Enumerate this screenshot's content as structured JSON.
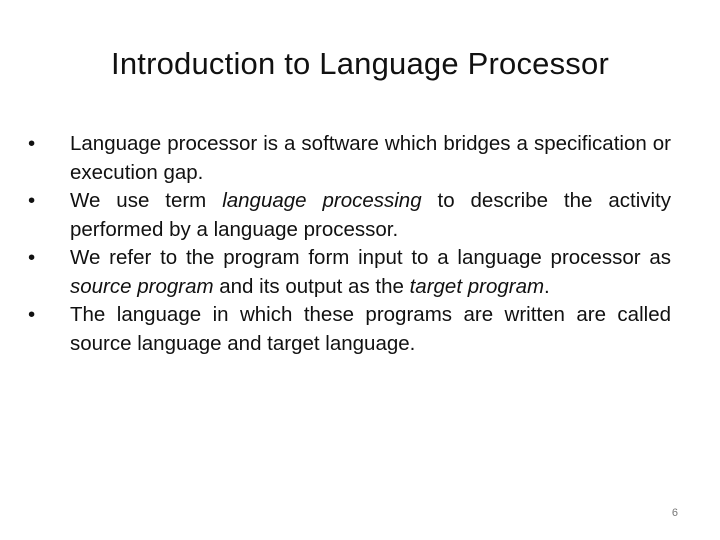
{
  "slide": {
    "title": "Introduction to Language Processor",
    "bullet_glyph": "•",
    "bullets": [
      {
        "segments": [
          {
            "text": "Language processor is a software which bridges a specification or execution gap.",
            "italic": false
          }
        ]
      },
      {
        "segments": [
          {
            "text": "We use term ",
            "italic": false
          },
          {
            "text": "language processing",
            "italic": true
          },
          {
            "text": " to describe the activity performed by a language processor.",
            "italic": false
          }
        ]
      },
      {
        "segments": [
          {
            "text": "We refer to the program form input to a language processor as ",
            "italic": false
          },
          {
            "text": "source program",
            "italic": true
          },
          {
            "text": " and its output as the ",
            "italic": false
          },
          {
            "text": "target program",
            "italic": true
          },
          {
            "text": ".",
            "italic": false
          }
        ]
      },
      {
        "segments": [
          {
            "text": "The language in which these programs are written are called source language and target language.",
            "italic": false
          }
        ]
      }
    ],
    "page_number": "6"
  }
}
